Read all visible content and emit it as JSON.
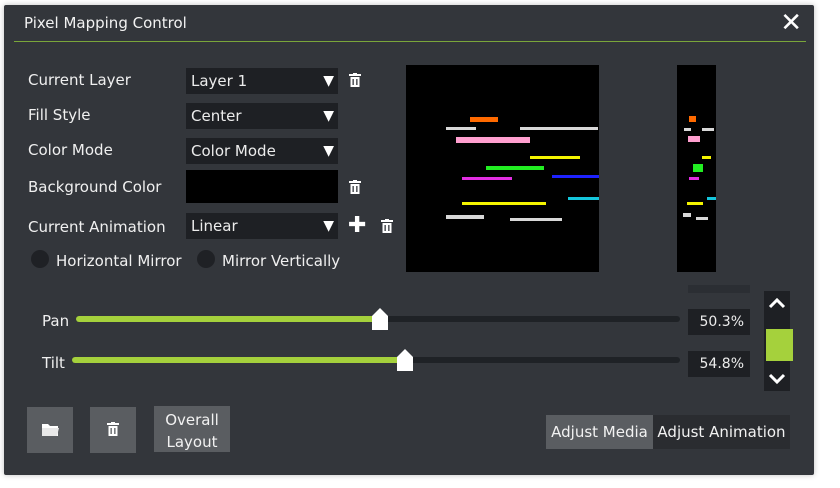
{
  "window": {
    "title": "Pixel Mapping Control",
    "close_glyph": "✕"
  },
  "fields": {
    "current_layer": {
      "label": "Current Layer",
      "value": "Layer 1"
    },
    "fill_style": {
      "label": "Fill Style",
      "value": "Center"
    },
    "color_mode": {
      "label": "Color Mode",
      "value": "Color Mode"
    },
    "background_color": {
      "label": "Background Color",
      "value": "#000000"
    },
    "current_animation": {
      "label": "Current Animation",
      "value": "Linear"
    }
  },
  "mirror": {
    "horizontal_label": "Horizontal Mirror",
    "vertical_label": "Mirror Vertically"
  },
  "sliders": {
    "pan": {
      "label": "Pan",
      "value": "50.3%",
      "fraction": 0.503
    },
    "tilt": {
      "label": "Tilt",
      "value": "54.8%",
      "fraction": 0.548
    }
  },
  "spinner": {
    "level_color": "#a5d13c"
  },
  "buttons": {
    "overall_line1": "Overall",
    "overall_line2": "Layout"
  },
  "tabs": {
    "media": "Adjust Media",
    "animation": "Adjust Animation",
    "active": "media"
  },
  "colors": {
    "accent": "#a5d13c",
    "orange": "#ff6a00",
    "pink": "#ff9fcf",
    "yellow": "#f4f400",
    "green": "#22ee22",
    "magenta": "#e22ee2",
    "blue": "#1e22ff",
    "cyan": "#14c6dc",
    "white": "#d8d8d8"
  }
}
